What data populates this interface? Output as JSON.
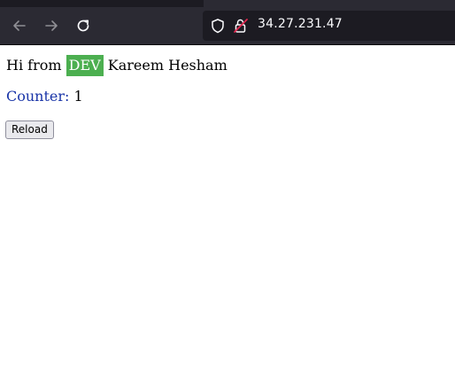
{
  "browser": {
    "url": "34.27.231.47"
  },
  "page": {
    "greeting_prefix": "Hi from",
    "environment_badge": "DEV",
    "name": "Kareem Hesham",
    "counter_label": "Counter:",
    "counter_value": "1",
    "reload_label": "Reload"
  },
  "colors": {
    "badge_background": "#4caf50",
    "counter_label": "#1a35a8"
  },
  "icons": {
    "back": "arrow-left-icon",
    "forward": "arrow-right-icon",
    "reload": "reload-icon",
    "tracking": "shield-icon",
    "security": "insecure-lock-icon"
  }
}
